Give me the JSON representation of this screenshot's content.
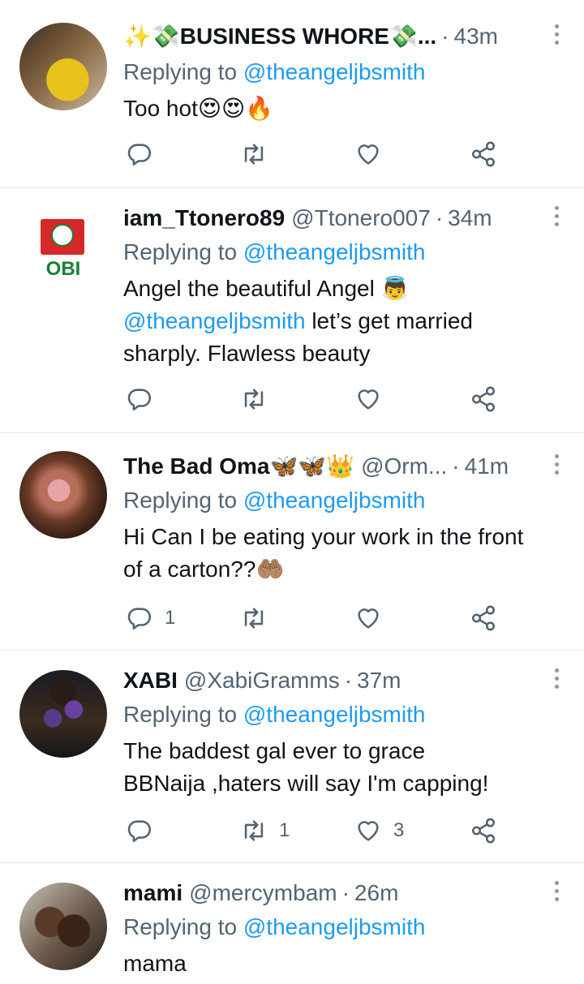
{
  "colors": {
    "accent": "#1d9bf0",
    "muted": "#536471",
    "text": "#0f1419",
    "divider": "#e6e9eb"
  },
  "reply_prefix": "Replying to",
  "tweets": [
    {
      "display_name": "✨💸BUSINESS WHORE💸...",
      "handle": "",
      "dot": "·",
      "time": "43m",
      "reply_to": "@theangeljbsmith",
      "text_lines": [
        "Too hot😍😍🔥"
      ],
      "reply_count": "",
      "retweet_count": "",
      "like_count": ""
    },
    {
      "display_name": "iam_Ttonero89",
      "handle": "@Ttonero007",
      "dot": "·",
      "time": "34m",
      "reply_to": "@theangeljbsmith",
      "text_lines": [
        "Angel the beautiful Angel 👼",
        "@theangeljbsmith",
        " let’s get married",
        "sharply. Flawless beauty"
      ],
      "avatar_text": "OBI",
      "reply_count": "",
      "retweet_count": "",
      "like_count": ""
    },
    {
      "display_name": "The Bad Oma🦋🦋👑",
      "handle": "@Orm...",
      "dot": "·",
      "time": "41m",
      "reply_to": "@theangeljbsmith",
      "text_lines": [
        "Hi Can I be eating your work in the front",
        "of a carton??🤲🏽"
      ],
      "reply_count": "1",
      "retweet_count": "",
      "like_count": ""
    },
    {
      "display_name": "XABI",
      "handle": "@XabiGramms",
      "dot": "·",
      "time": "37m",
      "reply_to": "@theangeljbsmith",
      "text_lines": [
        "The baddest gal ever to grace",
        "BBNaija ,haters will say I'm capping!"
      ],
      "reply_count": "",
      "retweet_count": "1",
      "like_count": "3"
    },
    {
      "display_name": "mami",
      "handle": "@mercymbam",
      "dot": "·",
      "time": "26m",
      "reply_to": "@theangeljbsmith",
      "text_lines": [
        "mama"
      ],
      "reply_count": "",
      "retweet_count": "",
      "like_count": ""
    }
  ]
}
